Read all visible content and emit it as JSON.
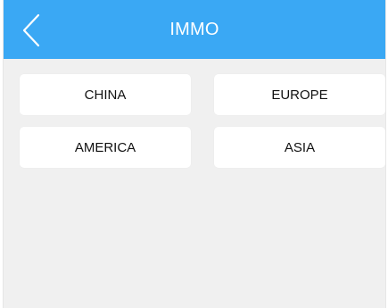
{
  "header": {
    "title": "IMMO",
    "back_icon": "chevron-left-icon"
  },
  "regions": [
    {
      "label": "CHINA"
    },
    {
      "label": "EUROPE"
    },
    {
      "label": "AMERICA"
    },
    {
      "label": "ASIA"
    }
  ],
  "colors": {
    "header_bg": "#3aa8f4",
    "page_bg": "#f0f0f0",
    "button_bg": "#ffffff",
    "button_text": "#111111",
    "header_text": "#ffffff"
  }
}
